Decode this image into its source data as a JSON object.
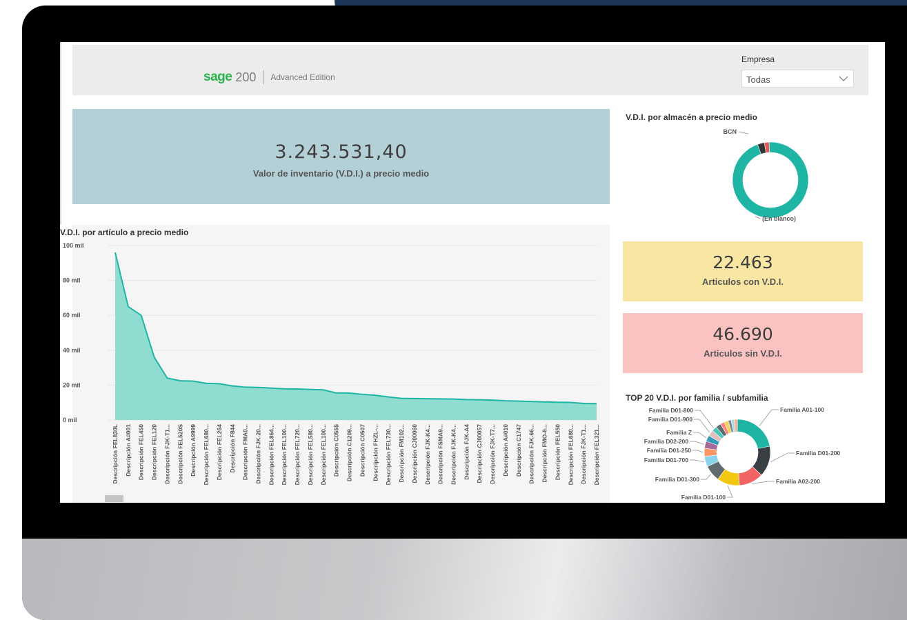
{
  "header": {
    "logo_brand": "sage",
    "logo_number": "200",
    "logo_edition": "Advanced Edition",
    "empresa_label": "Empresa",
    "empresa_value": "Todas"
  },
  "kpis": {
    "main_value": "3.243.531,40",
    "main_label": "Valor de inventario (V.D.I.) a precio medio",
    "with_value": "22.463",
    "with_label": "Articulos con V.D.I.",
    "without_value": "46.690",
    "without_label": "Articulos sin V.D.I."
  },
  "colors": {
    "teal": "#1fb5a5",
    "teal_fill": "#8fdcd1",
    "kpi_blue": "#b3d0d7",
    "kpi_yellow": "#f9e6a3",
    "kpi_red": "#fbc2c2"
  },
  "chart_data": [
    {
      "type": "area",
      "title": "V.D.I. por artículo a precio medio",
      "y_ticks": [
        "100 mil",
        "80 mil",
        "60 mil",
        "40 mil",
        "20 mil",
        "0 mil"
      ],
      "ylim": [
        0,
        100000
      ],
      "categories": [
        "Descripción FEL830L",
        "Descripción A#001",
        "Descripción FEL450",
        "Descripción FEL120",
        "Descripción FJK-T1...",
        "Descripción FEL520S",
        "Descripción A9999",
        "Descripción FEL680...",
        "Descripción FEL264",
        "Descripción F844",
        "Descripción FMA0...",
        "Descripción FJK-20...",
        "Descripción FEL864...",
        "Descripción FEL100...",
        "Descripción FEL720...",
        "Descripción FEL580...",
        "Descripción FEL100...",
        "Descripción C0555",
        "Descripción C1209...",
        "Descripción C0507",
        "Descripción FHZL-...",
        "Descripción FEL730...",
        "Descripción FM102...",
        "Descripción CJ00060",
        "Descripción FJK-K4...",
        "Descripción FSMA9...",
        "Descripción FJK-K4...",
        "Descripción FJK-A4",
        "Descripción CJ00057",
        "Descripción FJK-T7...",
        "Descripción A#010",
        "Descripción C1747",
        "Descripción FJK-66...",
        "Descripción FMO-6...",
        "Descripción FEL550",
        "Descripción FEL680...",
        "Descripción FJK-T1...",
        "Descripción FEL321..."
      ],
      "values": [
        96000,
        65000,
        60000,
        36000,
        24000,
        22500,
        22300,
        21000,
        20800,
        19500,
        18800,
        18700,
        18300,
        17900,
        17800,
        17500,
        17300,
        15500,
        15400,
        14700,
        14200,
        13200,
        12400,
        12300,
        12200,
        12100,
        12000,
        11700,
        11600,
        11400,
        11000,
        10800,
        10600,
        10400,
        10200,
        10100,
        9500,
        9400
      ],
      "grid": true
    },
    {
      "type": "pie",
      "title": "V.D.I. por almacén a precio medio",
      "labels": [
        "(En blanco)",
        "BCN",
        ""
      ],
      "values": [
        95,
        3,
        2
      ],
      "colors": [
        "#1fb5a5",
        "#333333",
        "#e25858"
      ]
    },
    {
      "type": "pie",
      "title": "TOP 20 V.D.I. por familia / subfamilia",
      "labels": [
        "Familia A01-100",
        "Familia D01-200",
        "Familia A02-200",
        "Familia D01-100",
        "Familia D01-300",
        "Familia D01-700",
        "Familia D01-250",
        "Familia D02-200",
        "Familia Z",
        "Familia D01-900",
        "Familia D01-800",
        "",
        "",
        "",
        "",
        "",
        ""
      ],
      "values": [
        22,
        15,
        12,
        11,
        8,
        5,
        4,
        3.5,
        3,
        3,
        2.5,
        2.5,
        2,
        2,
        1.5,
        1.5,
        1.5
      ],
      "colors": [
        "#1fb5a5",
        "#3a3f44",
        "#f26464",
        "#f2c811",
        "#5f6b6d",
        "#8ad4eb",
        "#fe9666",
        "#a66999",
        "#3599b8",
        "#dfbfbf",
        "#4ac5bb",
        "#5f6b6d",
        "#fb8281",
        "#f4d25a",
        "#7f898a",
        "#a4ddee",
        "#fdab89"
      ]
    }
  ]
}
